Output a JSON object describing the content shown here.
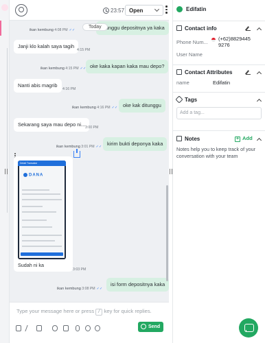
{
  "chat": {
    "time": "23:57",
    "status": "Open",
    "today_label": "Today",
    "messages": [
      {
        "dir": "out",
        "text": "ditunggu depositnya ya kaka",
        "time": "4:08 PM",
        "sender": "ikan kembung"
      },
      {
        "dir": "in",
        "text": "Janji klo kalah saya tagih",
        "time": "4:15 PM"
      },
      {
        "dir": "out",
        "text": "oke kaka kapan kaka mau depo?",
        "time": "4:15 PM",
        "sender": "ikan kembung"
      },
      {
        "dir": "in",
        "text": "Nanti abis magrib",
        "time": "4:16 PM"
      },
      {
        "dir": "out",
        "text": "oke kak ditunggu",
        "time": "4:16 PM",
        "sender": "ikan kembung"
      },
      {
        "dir": "in",
        "text": "Sekarang saya mau depo ni...",
        "time": "3:00 PM"
      },
      {
        "dir": "out",
        "text": "kirim bukti deponya kaka",
        "time": "3:01 PM",
        "sender": "ikan kembung"
      },
      {
        "dir": "out",
        "text": "isi form depositnya kaka",
        "time": "3:08 PM",
        "sender": "ikan kembung"
      }
    ],
    "image_message": {
      "caption": "Sudah ni ka",
      "time": "3:03 PM",
      "brand": "DANA",
      "screen_title": "Detail Transaksi"
    },
    "composer": {
      "placeholder_pre": "Type your message here or press",
      "placeholder_key": "/",
      "placeholder_post": "key for quick replies.",
      "send_label": "Send"
    }
  },
  "side": {
    "name": "Edifatin",
    "contact_info": {
      "title": "Contact info",
      "phone_label": "Phone Num...",
      "phone_value_line1": "(+62)8829445",
      "phone_value_line2": "9276",
      "username_label": "User Name"
    },
    "attributes": {
      "title": "Contact Attributes",
      "name_label": "name",
      "name_value": "Edifatin"
    },
    "tags": {
      "title": "Tags",
      "placeholder": "Add a tag..."
    },
    "notes": {
      "title": "Notes",
      "add_label": "Add",
      "description": "Notes help you to keep track of your conversation with your team"
    }
  }
}
